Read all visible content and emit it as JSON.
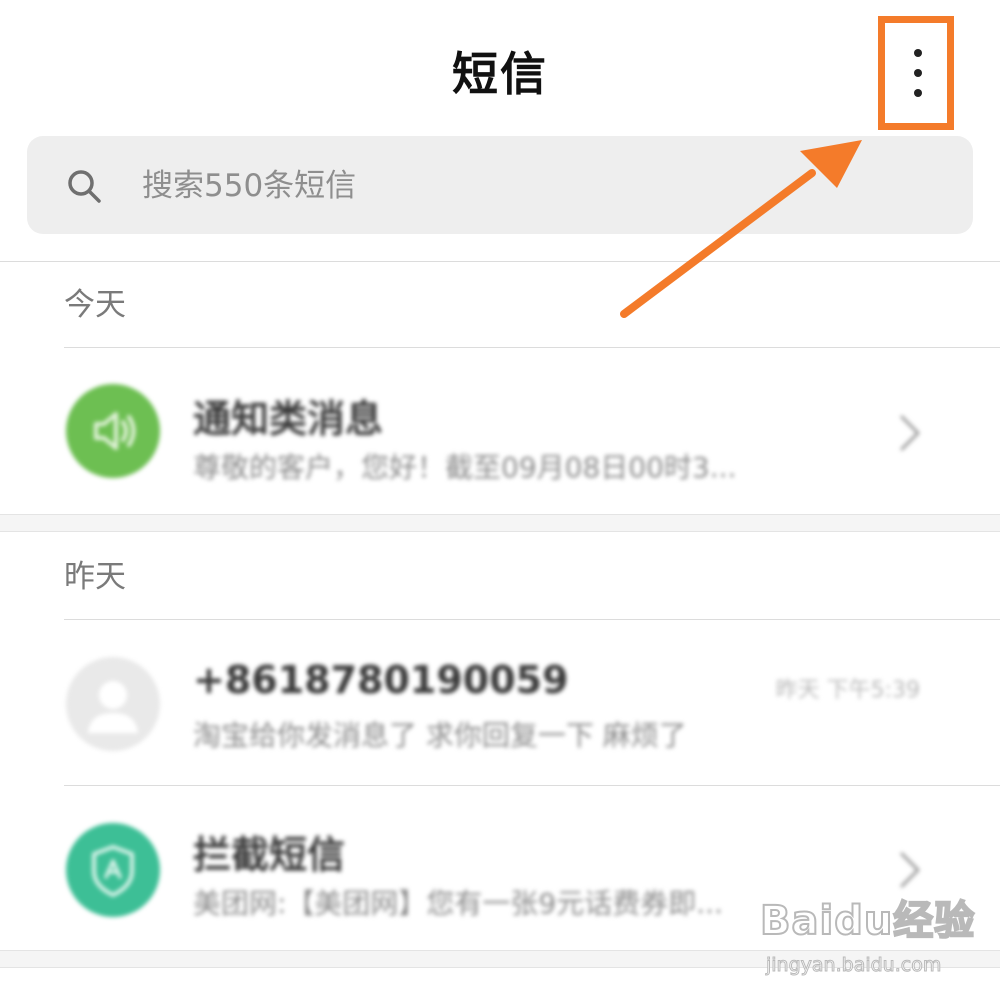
{
  "header": {
    "title": "短信",
    "more_icon": "more-vertical-icon",
    "highlight_color": "#f47b2a"
  },
  "search": {
    "placeholder": "搜索550条短信",
    "icon": "search-icon"
  },
  "sections": [
    {
      "label": "今天",
      "items": [
        {
          "title": "通知类消息",
          "preview": "尊敬的客户，您好！截至09月08日00时3...",
          "avatar_icon": "speaker-icon",
          "avatar_color": "#6dbf52",
          "trailing": "chevron-right-icon"
        }
      ]
    },
    {
      "label": "昨天",
      "items": [
        {
          "title": "+8618780190059",
          "preview": "淘宝给你发消息了 求你回复一下 麻烦了",
          "time": "昨天 下午5:39",
          "avatar_icon": "person-icon",
          "avatar_color": "#e6e6e6"
        },
        {
          "title": "拦截短信",
          "preview": "美团网:【美团网】您有一张9元话费券即...",
          "avatar_icon": "shield-icon",
          "avatar_color": "#3dbf96",
          "trailing": "chevron-right-icon"
        }
      ]
    }
  ],
  "watermark": {
    "logo": "Baidu经验",
    "site": "jingyan.baidu.com"
  }
}
